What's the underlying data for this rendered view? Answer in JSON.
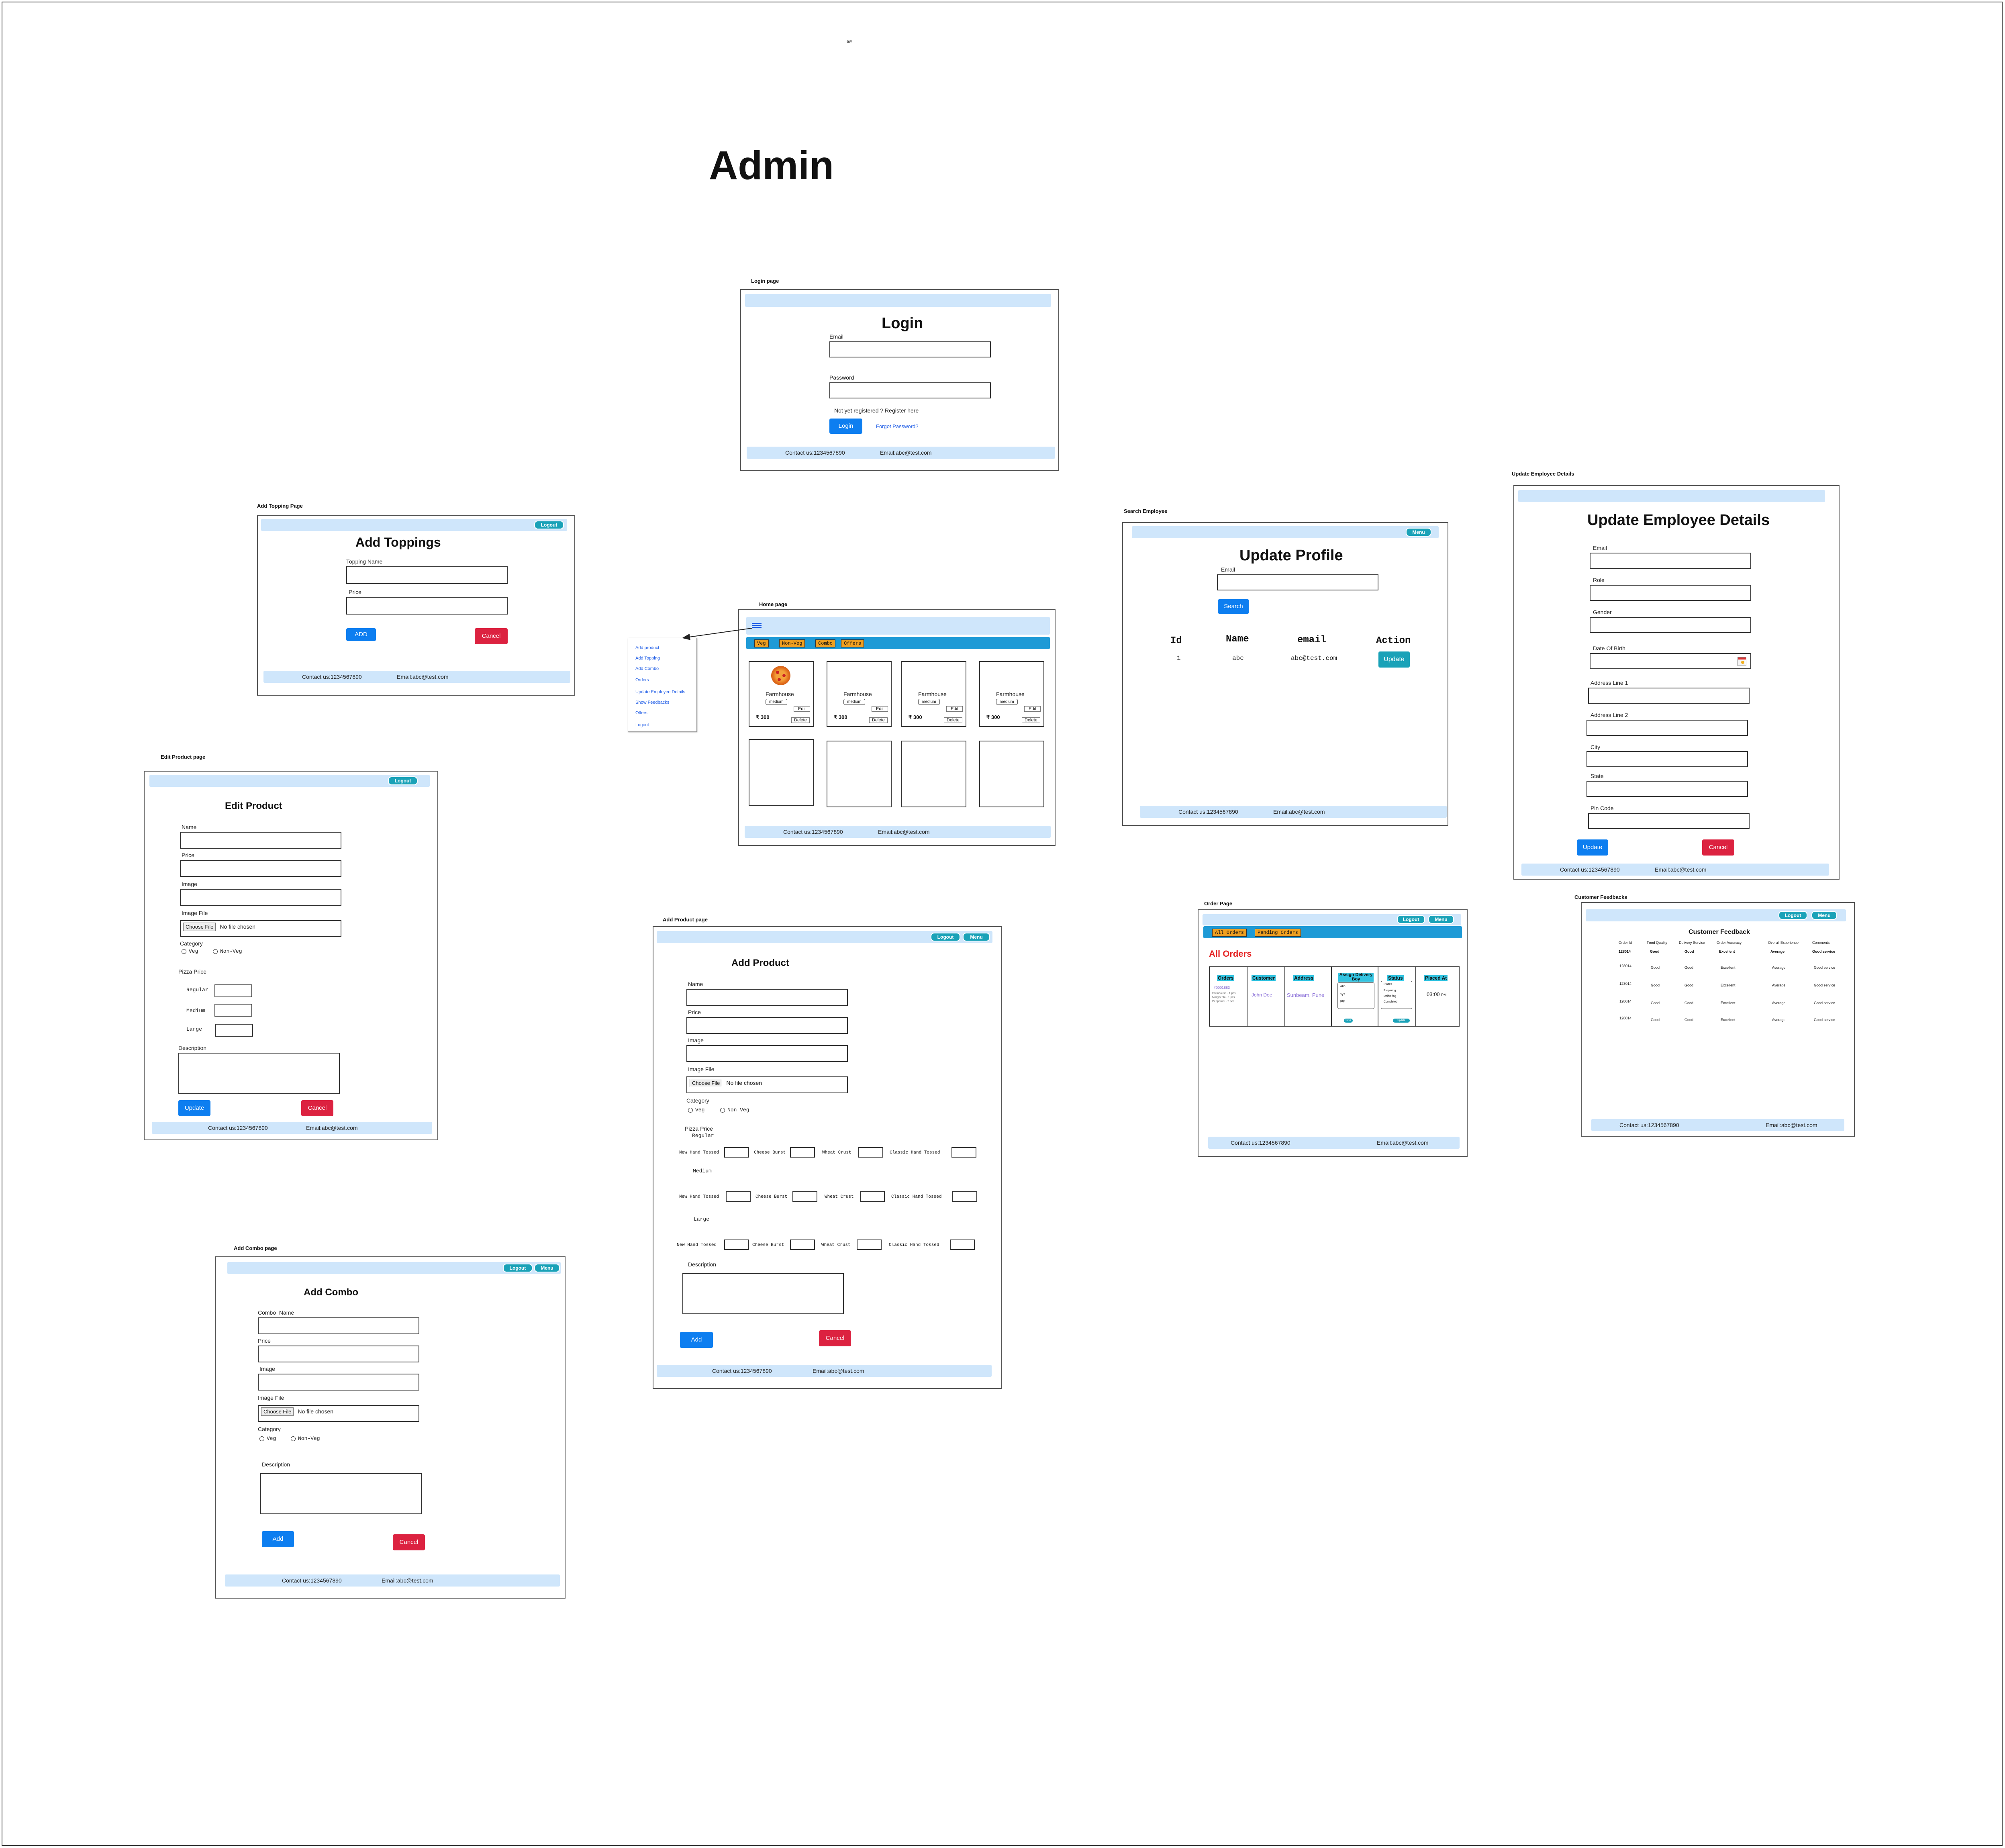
{
  "top_note": "aw",
  "title": "Admin",
  "login": {
    "caption": "Login page",
    "heading": "Login",
    "email_label": "Email",
    "password_label": "Password",
    "register_text": "Not yet registered ? Register here",
    "login_button": "Login",
    "forgot_link": "Forgot Password?"
  },
  "footer": {
    "contact": "Contact us:1234567890",
    "email": "Email:abc@test.com"
  },
  "buttons": {
    "logout": "Logout",
    "menu": "Menu",
    "update": "Update",
    "cancel": "Cancel",
    "add": "Add",
    "add_caps": "ADD",
    "search": "Search",
    "edit": "Edit",
    "delete": "Delete"
  },
  "toppings": {
    "caption": "Add Topping Page",
    "heading": "Add Toppings",
    "name_label": "Topping Name",
    "price_label": "Price"
  },
  "home": {
    "caption": "Home page",
    "menu_icon": "hamburger-icon",
    "tabs": [
      "Veg",
      "Non-Veg",
      "Combo",
      "Offers"
    ],
    "product_name": "Farmhouse",
    "size": "medium",
    "price": "₹ 300",
    "side_menu": [
      "Add product",
      "Add Topping",
      "Add Combo",
      "Orders",
      "Update Employee Details",
      "Show Feedbacks",
      "Offers",
      "Logout"
    ]
  },
  "search_employee": {
    "caption": "Search Employee",
    "heading": "Update Profile",
    "email_label": "Email",
    "columns": [
      "Id",
      "Name",
      "email",
      "Action"
    ],
    "row": [
      "1",
      "abc",
      "abc@test.com"
    ]
  },
  "update_employee": {
    "caption": "Update Employee Details",
    "heading": "Update Employee Details",
    "fields": [
      "Email",
      "Role",
      "Gender",
      "Date Of Birth",
      "Address Line 1",
      "Address Line 2",
      "City",
      "State",
      "Pin Code"
    ]
  },
  "edit_product": {
    "caption": "Edit Product page",
    "heading": "Edit Product",
    "name_label": "Name",
    "price_label": "Price",
    "image_label": "Image",
    "image_file_label": "Image File",
    "choose_file": "Choose File",
    "no_file": "No file chosen",
    "category_label": "Category",
    "veg": "Veg",
    "non_veg": "Non-Veg",
    "pizza_price_label": "Pizza Price",
    "sizes": [
      "Regular",
      "Medium",
      "Large"
    ],
    "description_label": "Description"
  },
  "add_product": {
    "caption": "Add Product page",
    "heading": "Add Product",
    "pizza_price_label": "Pizza Price",
    "crusts": [
      "New Hand Tossed",
      "Cheese Burst",
      "Wheat Crust",
      "Classic Hand Tossed"
    ],
    "sizes": [
      "Regular",
      "Medium",
      "Large"
    ]
  },
  "order_page": {
    "caption": "Order Page",
    "tabs": [
      "All Orders",
      "Pending Orders"
    ],
    "heading": "All Orders",
    "columns": [
      "Orders",
      "Customer",
      "Address",
      "Assign Delivery Boy",
      "Status",
      "Placed At"
    ],
    "order_id": "#0001883",
    "order_items": [
      "Farmhouse - 1 pcs",
      "Margherita - 1 pcs",
      "Pepperoni - 2 pcs"
    ],
    "customer": "John Doe",
    "address": "Sunbeam, Pune",
    "delivery_options": [
      "abc",
      "xyz",
      "pqr"
    ],
    "status_options": [
      "Placed",
      "Preparing",
      "Delivering",
      "Completed"
    ],
    "placed_at": "03:00",
    "placed_suffix": "PM",
    "assign_btn": "Save",
    "status_btn": "Update"
  },
  "feedback": {
    "caption": "Customer Feedbacks",
    "heading": "Customer Feedback",
    "columns": [
      "Order Id",
      "Food Quality",
      "Delivery Service",
      "Order Accuracy",
      "Overall Experience",
      "Comments"
    ],
    "rows": [
      [
        "128014",
        "Good",
        "Good",
        "Excellent",
        "Average",
        "Good service"
      ],
      [
        "128014",
        "Good",
        "Good",
        "Excellent",
        "Average",
        "Good service"
      ],
      [
        "128014",
        "Good",
        "Good",
        "Excellent",
        "Average",
        "Good service"
      ],
      [
        "128014",
        "Good",
        "Good",
        "Excellent",
        "Average",
        "Good service"
      ],
      [
        "128014",
        "Good",
        "Good",
        "Excellent",
        "Average",
        "Good service"
      ]
    ]
  },
  "combo": {
    "caption": "Add Combo page",
    "heading": "Add Combo",
    "name_label": "Combo  Name",
    "price_label": "Price",
    "image_label": "Image",
    "image_file_label": "Image File",
    "category_label": "Category",
    "description_label": "Description"
  }
}
